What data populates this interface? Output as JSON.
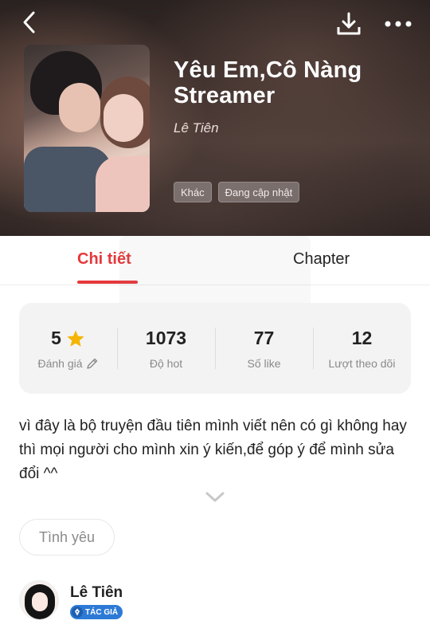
{
  "header": {
    "title": "Yêu Em,Cô Nàng Streamer",
    "author": "Lê Tiên",
    "tags": [
      "Khác",
      "Đang cập nhật"
    ],
    "icons": {
      "back": "chevron-left-icon",
      "download": "download-icon",
      "more": "more-dots-icon"
    }
  },
  "tabs": [
    {
      "label": "Chi tiết",
      "active": true
    },
    {
      "label": "Chapter",
      "active": false
    }
  ],
  "stats": [
    {
      "value": "5",
      "label": "Đánh giá",
      "icon": "star-icon",
      "label_icon": "pencil-icon"
    },
    {
      "value": "1073",
      "label": "Độ hot"
    },
    {
      "value": "77",
      "label": "Số like"
    },
    {
      "value": "12",
      "label": "Lượt theo dõi"
    }
  ],
  "description": "vì đây là bộ truyện đầu tiên mình viết nên có gì không hay thì mọi người cho mình xin ý kiến,để góp ý để mình sửa đổi ^^",
  "genre": "Tình yêu",
  "author_card": {
    "name": "Lê Tiên",
    "badge": "TÁC GIẢ"
  },
  "colors": {
    "accent": "#e5383b",
    "badge": "#2d7ad6",
    "star": "#f5b400"
  }
}
